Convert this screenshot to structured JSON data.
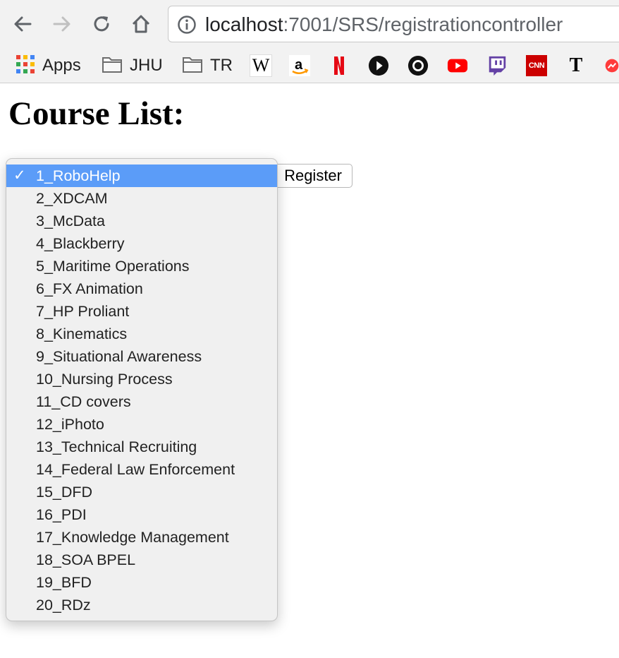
{
  "browser": {
    "url_host": "localhost",
    "url_rest": ":7001/SRS/registrationcontroller"
  },
  "bookmarks": {
    "apps_label": "Apps",
    "folder1_label": "JHU",
    "folder2_label": "TR",
    "wikipedia_glyph": "W",
    "cnn_glyph": "CNN",
    "nyt_glyph": "T",
    "icons": [
      "apps-grid-icon",
      "folder-icon",
      "folder-icon",
      "wikipedia-icon",
      "amazon-icon",
      "netflix-icon",
      "play-circle-icon",
      "record-circle-icon",
      "youtube-icon",
      "twitch-icon",
      "cnn-icon",
      "nyt-icon",
      "partial-red-icon"
    ]
  },
  "page": {
    "title": "Course List:",
    "register_label": "Register"
  },
  "course_select": {
    "selected_index": 0,
    "check_glyph": "✓",
    "options": [
      "1_RoboHelp",
      "2_XDCAM",
      "3_McData",
      "4_Blackberry",
      "5_Maritime Operations",
      "6_FX Animation",
      "7_HP Proliant",
      "8_Kinematics",
      "9_Situational Awareness",
      "10_Nursing Process",
      "11_CD covers",
      "12_iPhoto",
      "13_Technical Recruiting",
      "14_Federal Law Enforcement",
      "15_DFD",
      "16_PDI",
      "17_Knowledge Management",
      "18_SOA BPEL",
      "19_BFD",
      "20_RDz"
    ]
  },
  "colors": {
    "selection": "#5b9cf8",
    "netflix": "#e50914",
    "youtube": "#ff0000",
    "twitch": "#6441a5",
    "cnn": "#cc0000"
  }
}
